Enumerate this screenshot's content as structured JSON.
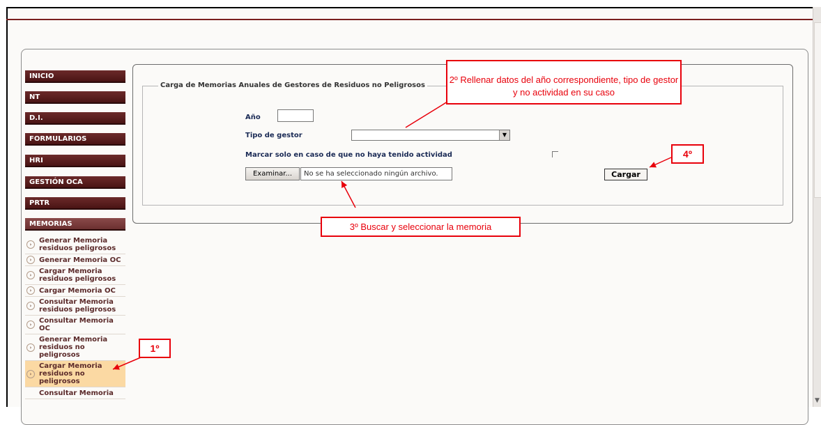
{
  "nav": {
    "inicio": "INICIO",
    "nt": "NT",
    "di": "D.I.",
    "formularios": "FORMULARIOS",
    "hri": "HRI",
    "gestion_oca": "GESTIÓN OCA",
    "prtr": "PRTR",
    "memorias": "MEMORIAS"
  },
  "submenu": [
    "Generar Memoria residuos peligrosos",
    "Generar Memoria OC",
    "Cargar Memoria residuos peligrosos",
    "Cargar Memoria OC",
    "Consultar Memoria residuos peligrosos",
    "Consultar Memoria OC",
    "Generar Memoria residuos no peligrosos",
    "Cargar Memoria residuos no peligrosos",
    "Consultar Memoria"
  ],
  "form": {
    "legend": "Carga de Memorias Anuales de Gestores de Residuos no Peligrosos",
    "year_label": "Año",
    "type_label": "Tipo de gestor",
    "no_activity_label": "Marcar solo en caso de que no haya tenido actividad",
    "browse_button": "Examinar...",
    "file_status": "No se ha seleccionado ningún archivo.",
    "upload_button": "Cargar"
  },
  "annotations": {
    "step1": "1º",
    "step2": "2º Rellenar datos del año correspondiente, tipo de gestor y no actividad en su caso",
    "step3": "3º Buscar y seleccionar la memoria",
    "step4": "4º"
  },
  "colors": {
    "nav_bg": "#5a1e1e",
    "callout": "#e8000b",
    "selected": "#fbd9a3"
  }
}
